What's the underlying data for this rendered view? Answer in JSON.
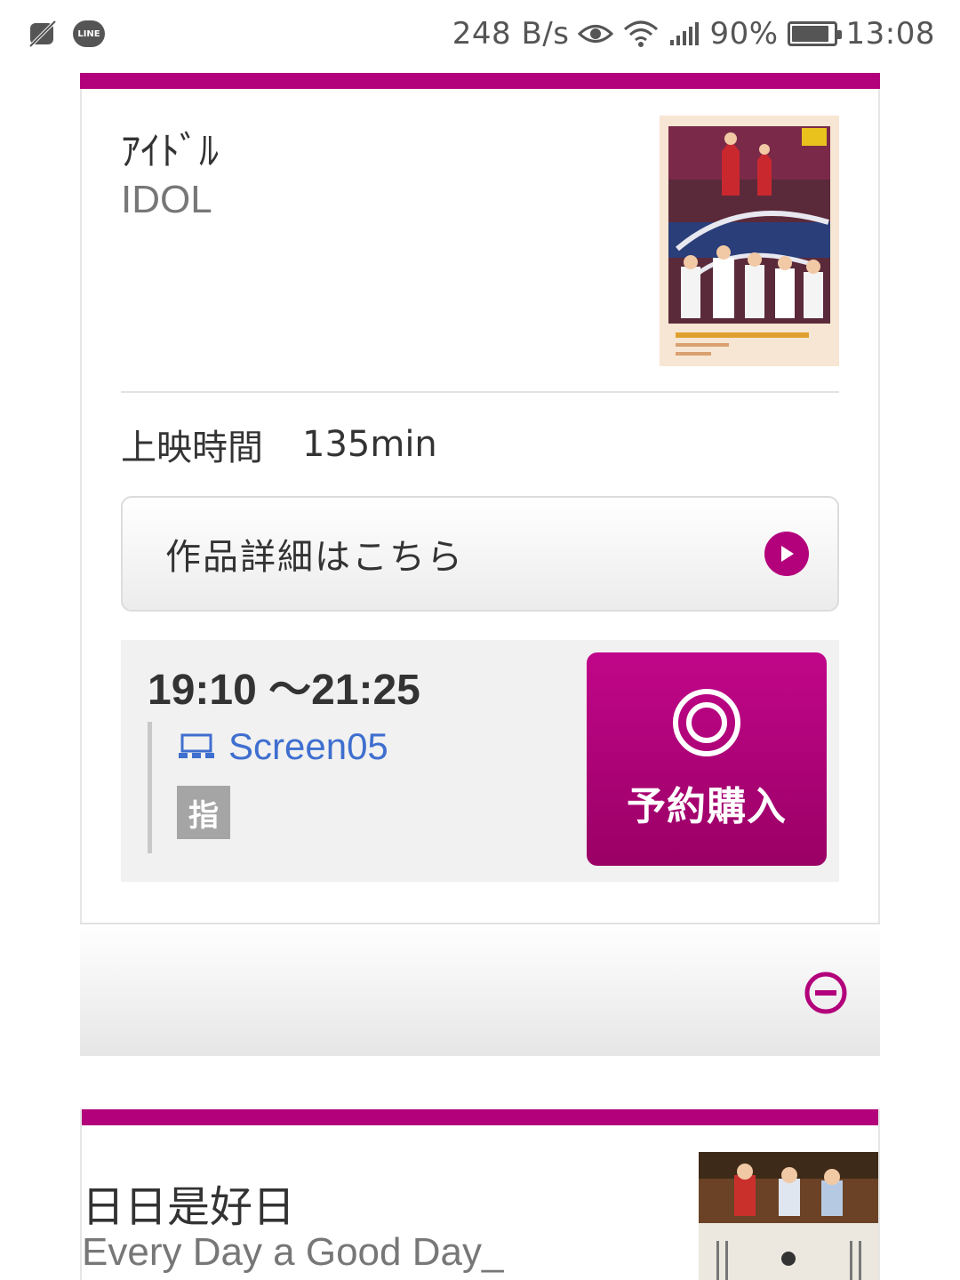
{
  "status_bar": {
    "network_speed": "248 B/s",
    "battery": "90%",
    "battery_level": 0.9,
    "time": "13:08",
    "line_badge": "LINE"
  },
  "movies": [
    {
      "title_jp": "ｱｲﾄﾞﾙ",
      "title_en": "IDOL",
      "runtime_label": "上映時間",
      "runtime_value": "135min",
      "detail_button": "作品詳細はこちら",
      "showtime": {
        "time_range": "19:10 〜21:25",
        "screen": "Screen05",
        "seat_badge": "指",
        "reserve_label": "予約購入"
      }
    },
    {
      "title_jp": "日日是好日",
      "title_en": "Every Day a Good Day_"
    }
  ],
  "colors": {
    "brand": "#b3007b",
    "link": "#3f6fcf"
  }
}
